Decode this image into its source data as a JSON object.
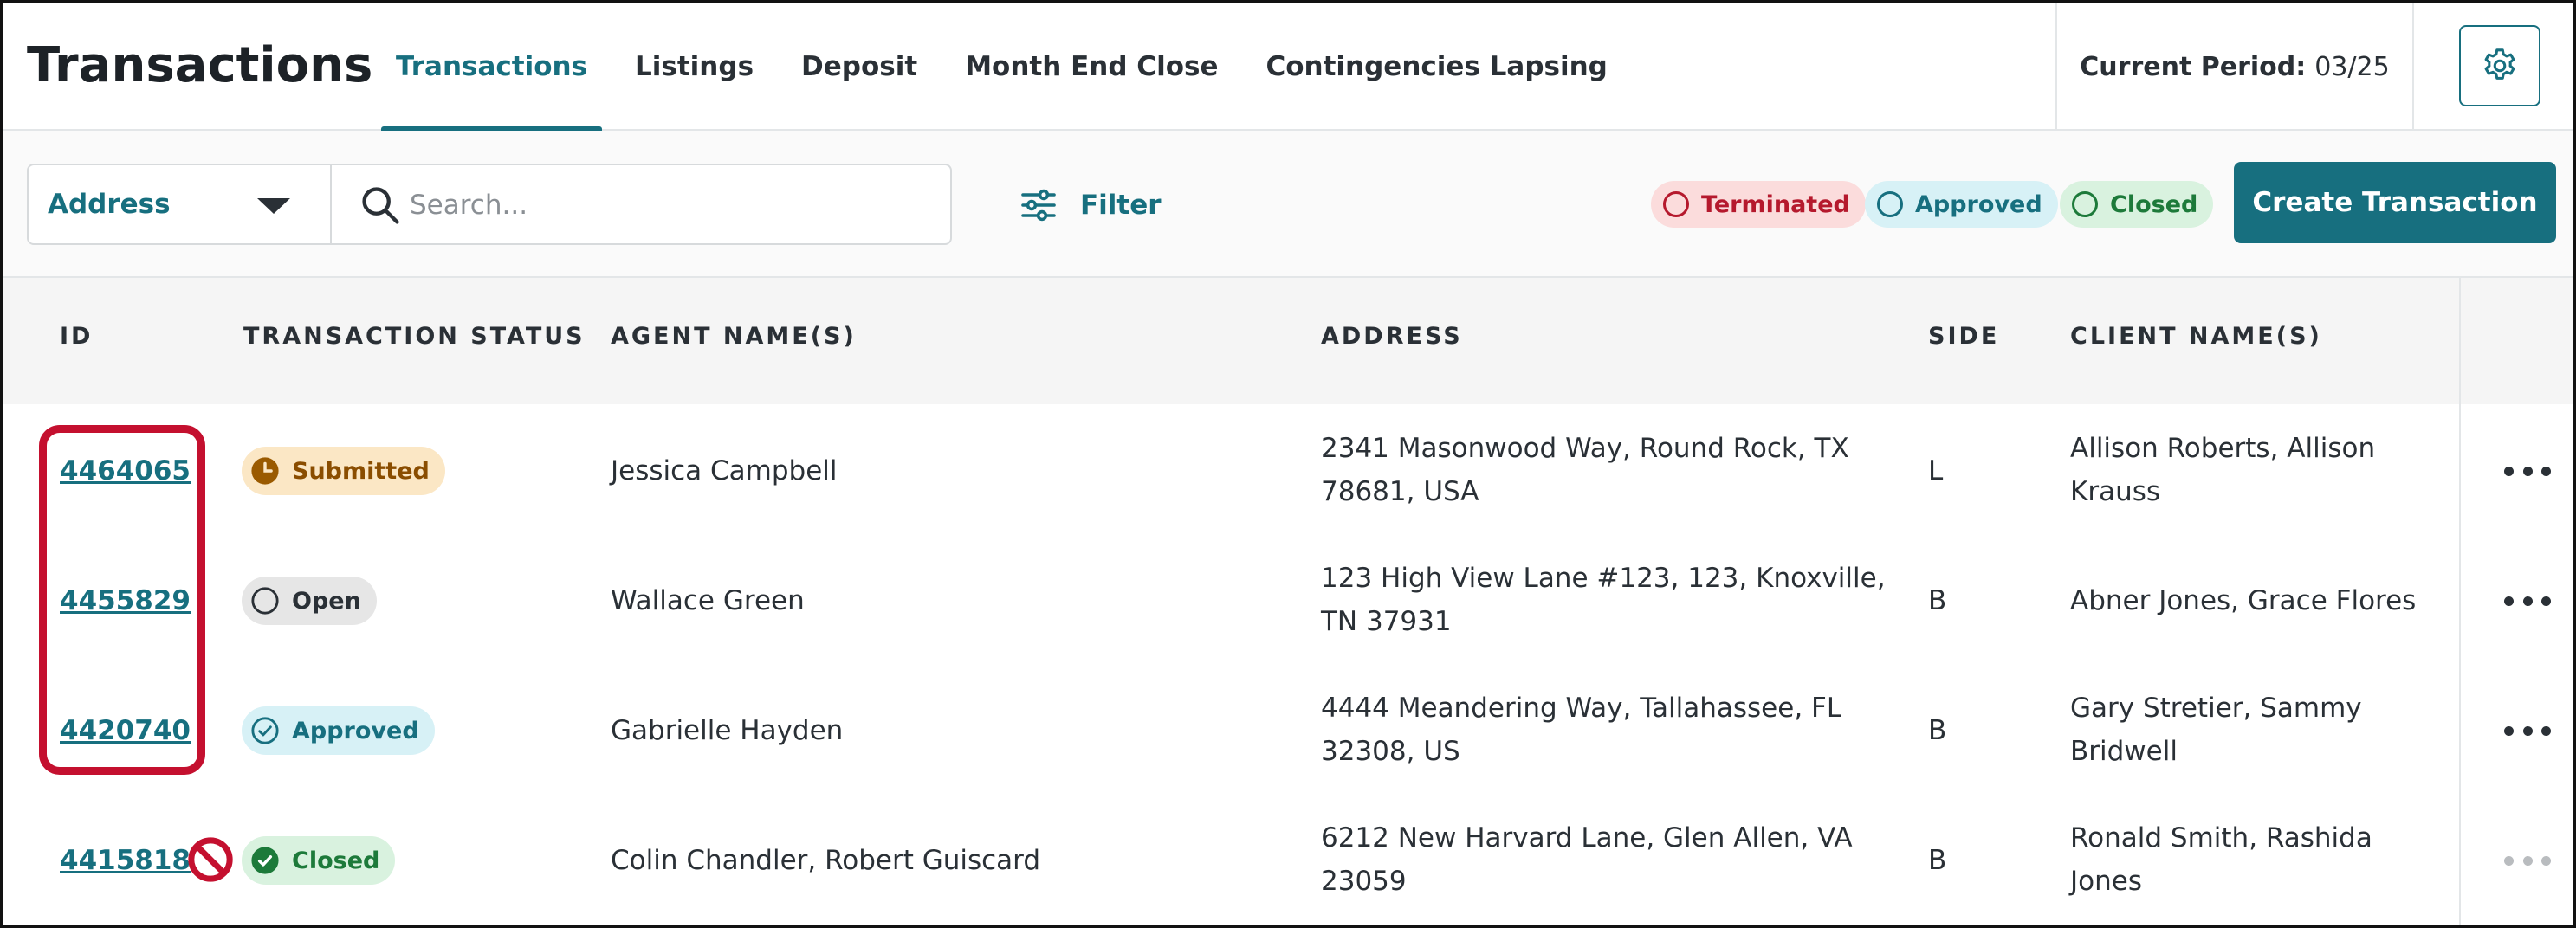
{
  "app": {
    "title": "Transactions"
  },
  "nav": {
    "tabs": [
      {
        "label": "Transactions",
        "active": true
      },
      {
        "label": "Listings",
        "active": false
      },
      {
        "label": "Deposit",
        "active": false
      },
      {
        "label": "Month End Close",
        "active": false
      },
      {
        "label": "Contingencies Lapsing",
        "active": false
      }
    ]
  },
  "period": {
    "label": "Current Period:",
    "value": "03/25"
  },
  "settings": {
    "icon": "gear-icon"
  },
  "toolbar": {
    "search_field": {
      "selected": "Address"
    },
    "search": {
      "placeholder": "Search..."
    },
    "filter_label": "Filter",
    "chips": [
      {
        "label": "Terminated",
        "color": "#b5192d"
      },
      {
        "label": "Approved",
        "color": "#176f7f"
      },
      {
        "label": "Closed",
        "color": "#1d7a3a"
      }
    ],
    "create_label": "Create Transaction"
  },
  "table": {
    "columns": [
      "ID",
      "TRANSACTION STATUS",
      "AGENT NAME(S)",
      "ADDRESS",
      "SIDE",
      "CLIENT NAME(S)"
    ],
    "rows": [
      {
        "id": "4464065",
        "status": "Submitted",
        "agents": "Jessica Campbell",
        "address_line1": "2341 Masonwood Way, Round Rock, TX",
        "address_line2": "78681, USA",
        "side": "L",
        "clients_line1": "Allison Roberts, Allison",
        "clients_line2": "Krauss"
      },
      {
        "id": "4455829",
        "status": "Open",
        "agents": "Wallace Green",
        "address_line1": "123 High View Lane #123, 123, Knoxville,",
        "address_line2": "TN 37931",
        "side": "B",
        "clients_line1": "Abner Jones, Grace Flores",
        "clients_line2": ""
      },
      {
        "id": "4420740",
        "status": "Approved",
        "agents": "Gabrielle Hayden",
        "address_line1": "4444 Meandering Way, Tallahassee, FL",
        "address_line2": "32308, US",
        "side": "B",
        "clients_line1": "Gary Stretier, Sammy",
        "clients_line2": "Bridwell"
      },
      {
        "id": "4415818",
        "status": "Closed",
        "agents": "Colin Chandler, Robert Guiscard",
        "address_line1": "6212 New Harvard Lane, Glen Allen, VA",
        "address_line2": "23059",
        "side": "B",
        "clients_line1": "Ronald Smith, Rashida",
        "clients_line2": "Jones"
      }
    ]
  },
  "annotations": {
    "highlight_color": "#c4102f"
  }
}
